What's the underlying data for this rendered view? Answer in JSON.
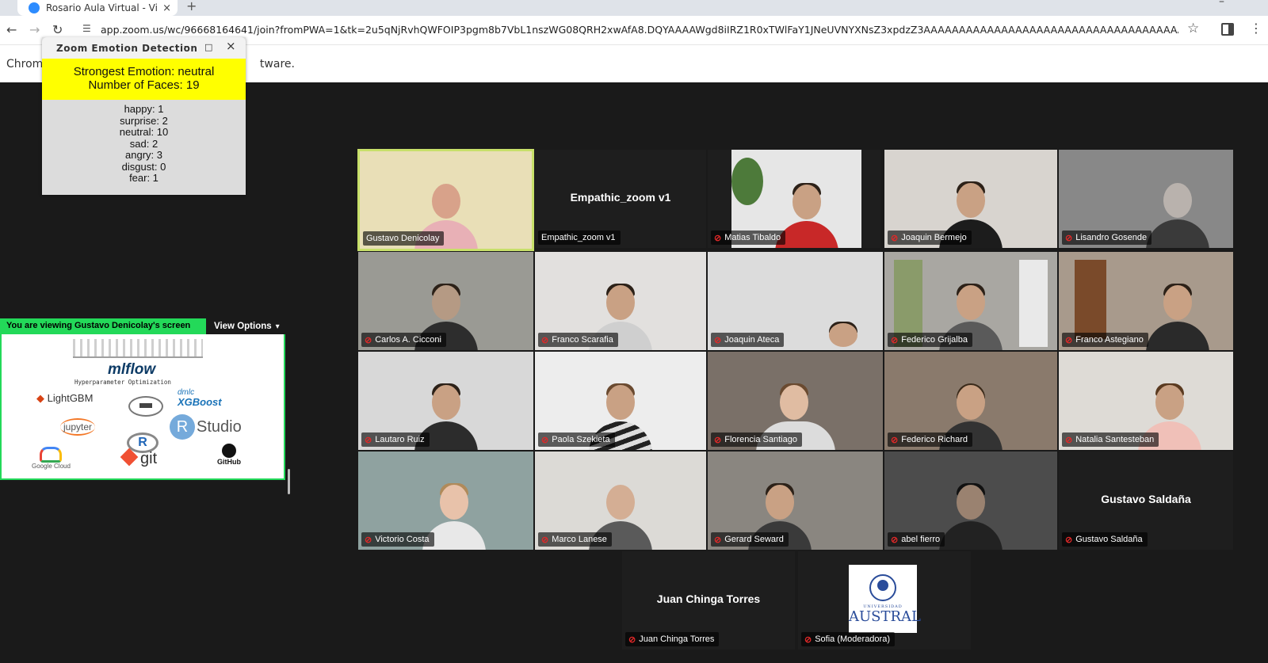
{
  "browser": {
    "tab_title": "Rosario Aula Virtual - Vi",
    "tab_close": "×",
    "new_tab": "+",
    "url": "app.zoom.us/wc/96668164641/join?fromPWA=1&tk=2u5qNjRvhQWFOIP3pgm8b7VbL1nszWG08QRH2xwAfA8.DQYAAAAWgd8iIRZ1R0xTWlFaY1JNeUVNYXNsZ3xpdzZ3AAAAAAAAAAAAAAAAAAAAAAAAAAAAAAAAAAAAAA&_x_zm_rtaid=rkp_kb...",
    "infobar_prefix": "Chrome",
    "infobar_suffix": "tware."
  },
  "emotion_window": {
    "title": "Zoom Emotion Detection",
    "minimize": "–",
    "maximize": "□",
    "close": "×",
    "strongest": "Strongest Emotion: neutral",
    "faces": "Number of Faces: 19",
    "lines": [
      "happy: 1",
      "surprise: 2",
      "neutral: 10",
      "sad: 2",
      "angry: 3",
      "disgust: 0",
      "fear: 1"
    ]
  },
  "share": {
    "viewing_text": "You are viewing  Gustavo Denicolay's screen",
    "view_options": "View Options",
    "logos": {
      "mlflow": "mlflow",
      "hyperparam": "Hyperparameter Optimization",
      "lightgbm": "LightGBM",
      "dmlc": "dmlc",
      "xgboost": "XGBoost",
      "jupyter": "jupyter",
      "r": "R",
      "studio": "Studio",
      "git": "git",
      "google_cloud": "Google Cloud",
      "github": "GitHub"
    }
  },
  "participants": [
    {
      "name": "Gustavo Denicolay",
      "type": "video",
      "muted": false,
      "active": true
    },
    {
      "name": "Empathic_zoom v1",
      "type": "name-only",
      "muted": false,
      "display": "Empathic_zoom v1"
    },
    {
      "name": "Matias Tibaldo",
      "type": "video",
      "muted": true
    },
    {
      "name": "Joaquin Bermejo",
      "type": "video",
      "muted": true
    },
    {
      "name": "Lisandro Gosende",
      "type": "video",
      "muted": true
    },
    {
      "name": "Carlos A. Cicconi",
      "type": "video",
      "muted": true
    },
    {
      "name": "Franco Scarafia",
      "type": "video",
      "muted": true
    },
    {
      "name": "Joaquin Ateca",
      "type": "video",
      "muted": true
    },
    {
      "name": "Federico Grijalba",
      "type": "video",
      "muted": true
    },
    {
      "name": "Franco Astegiano",
      "type": "video",
      "muted": true
    },
    {
      "name": "Lautaro Ruiz",
      "type": "video",
      "muted": true
    },
    {
      "name": "Paola Szekieta",
      "type": "video",
      "muted": true
    },
    {
      "name": "Florencia Santiago",
      "type": "video",
      "muted": true
    },
    {
      "name": "Federico Richard",
      "type": "video",
      "muted": true
    },
    {
      "name": "Natalia Santesteban",
      "type": "video",
      "muted": true
    },
    {
      "name": "Victorio Costa",
      "type": "video",
      "muted": true
    },
    {
      "name": "Marco Lanese",
      "type": "video",
      "muted": true
    },
    {
      "name": "Gerard Seward",
      "type": "video",
      "muted": true
    },
    {
      "name": "abel fierro",
      "type": "video",
      "muted": true
    },
    {
      "name": "Gustavo Saldaña",
      "type": "name-only",
      "muted": true,
      "display": "Gustavo Saldaña"
    },
    {
      "name": "Juan Chinga Torres",
      "type": "name-only",
      "muted": true,
      "display": "Juan Chinga Torres"
    },
    {
      "name": "Sofia (Moderadora)",
      "type": "logo",
      "muted": true
    }
  ],
  "austral_logo": {
    "univ": "UNIVERSIDAD",
    "word": "AUSTRAL"
  },
  "colors": {
    "share_green": "#23d959",
    "active_speaker": "#c8e06a",
    "banner_yellow": "#ffff00",
    "muted_red": "#e02828"
  }
}
